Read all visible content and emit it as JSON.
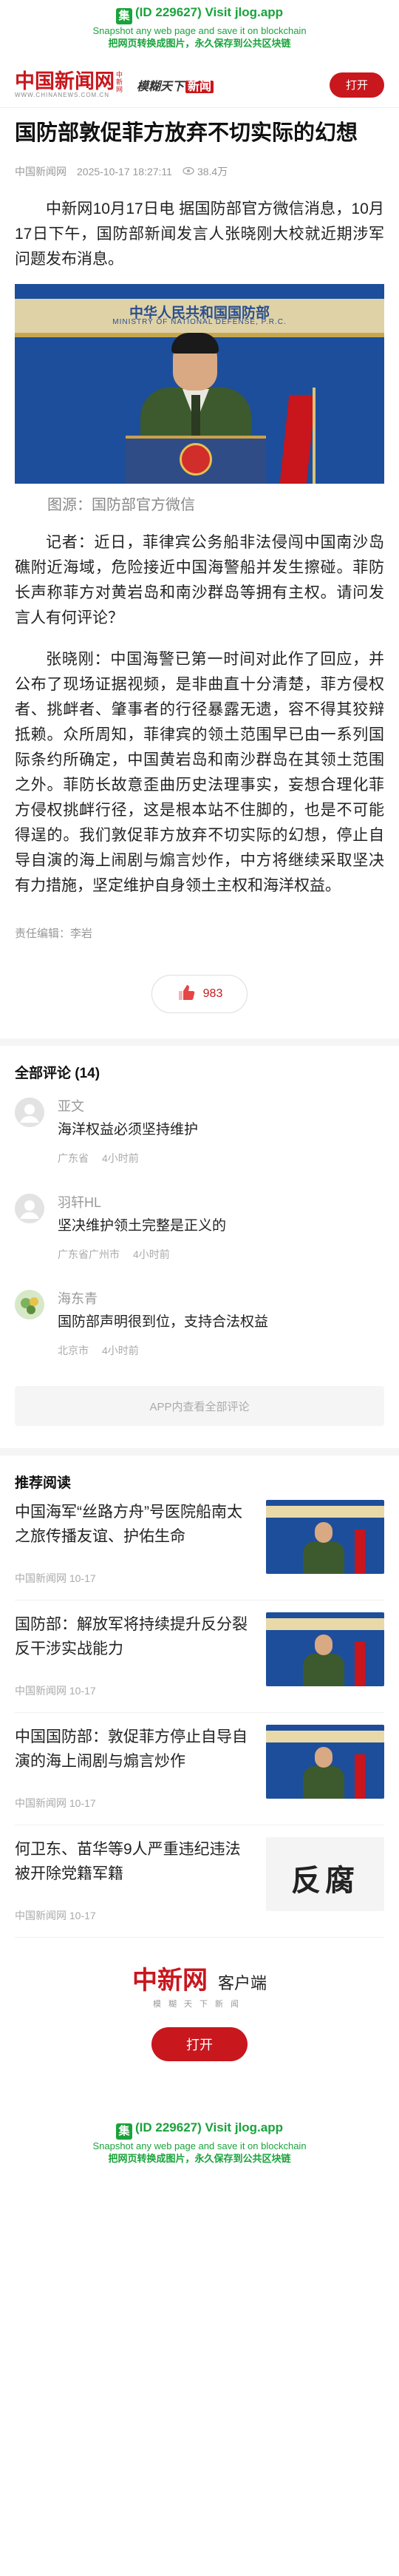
{
  "banner": {
    "line1_icon": "集",
    "line1": "(ID 229627) Visit jlog.app",
    "line2": "Snapshot any web page and save it on blockchain",
    "line3": "把网页转换成图片，永久保存到公共区块链"
  },
  "header": {
    "logo": "中国新闻网",
    "logo_vert": "中新网",
    "logo_sub": "WWW.CHINANEWS.COM.CN",
    "slogan": "模糊天下",
    "slogan_red": "新闻",
    "open_label": "打开"
  },
  "article": {
    "title": "国防部敦促菲方放弃不切实际的幻想",
    "source": "中国新闻网",
    "time": "2025-10-17 18:27:11",
    "views": "38.4万",
    "paragraphs": [
      "中新网10月17日电 据国防部官方微信消息，10月17日下午，国防部新闻发言人张晓刚大校就近期涉军问题发布消息。",
      "记者：近日，菲律宾公务船非法侵闯中国南沙岛礁附近海域，危险接近中国海警船并发生擦碰。菲防长声称菲方对黄岩岛和南沙群岛等拥有主权。请问发言人有何评论？",
      "张晓刚：中国海警已第一时间对此作了回应，并公布了现场证据视频，是非曲直十分清楚，菲方侵权者、挑衅者、肇事者的行径暴露无遗，容不得其狡辩抵赖。众所周知，菲律宾的领土范围早已由一系列国际条约所确定，中国黄岩岛和南沙群岛在其领土范围之外。菲防长故意歪曲历史法理事实，妄想合理化菲方侵权挑衅行径，这是根本站不住脚的，也是不可能得逞的。我们敦促菲方放弃不切实际的幻想，停止自导自演的海上闹剧与煽言炒作，中方将继续采取坚决有力措施，坚定维护自身领土主权和海洋权益。"
    ],
    "photo": {
      "title": "中华人民共和国国防部",
      "subtitle": "MINISTRY OF NATIONAL DEFENSE, P.R.C."
    },
    "caption": "图源：国防部官方微信",
    "editor": "责任编辑：李岩",
    "likes": "983"
  },
  "comments": {
    "title": "全部评论 (14)",
    "items": [
      {
        "name": "亚文",
        "text": "海洋权益必须坚持维护",
        "location": "广东省",
        "time": "4小时前"
      },
      {
        "name": "羽轩HL",
        "text": "坚决维护领土完整是正义的",
        "location": "广东省广州市",
        "time": "4小时前"
      },
      {
        "name": "海东青",
        "text": "国防部声明很到位，支持合法权益",
        "location": "北京市",
        "time": "4小时前"
      }
    ],
    "more_label": "APP内查看全部评论"
  },
  "recommend": {
    "title": "推荐阅读",
    "items": [
      {
        "title": "中国海军“丝路方舟”号医院船南太之旅传播友谊、护佑生命",
        "source": "中国新闻网",
        "date": "10-17"
      },
      {
        "title": "国防部：解放军将持续提升反分裂反干涉实战能力",
        "source": "中国新闻网",
        "date": "10-17"
      },
      {
        "title": "中国国防部：敦促菲方停止自导自演的海上闹剧与煽言炒作",
        "source": "中国新闻网",
        "date": "10-17"
      },
      {
        "title": "何卫东、苗华等9人严重违纪违法被开除党籍军籍",
        "source": "中国新闻网",
        "date": "10-17",
        "thumb_text": "反腐"
      }
    ]
  },
  "app": {
    "logo": "中新网",
    "client": "客户端",
    "slogan": "模糊天下新闻",
    "open_label": "打开"
  },
  "colors": {
    "brand": "#c8171d",
    "banner_green": "#1aa33c"
  }
}
